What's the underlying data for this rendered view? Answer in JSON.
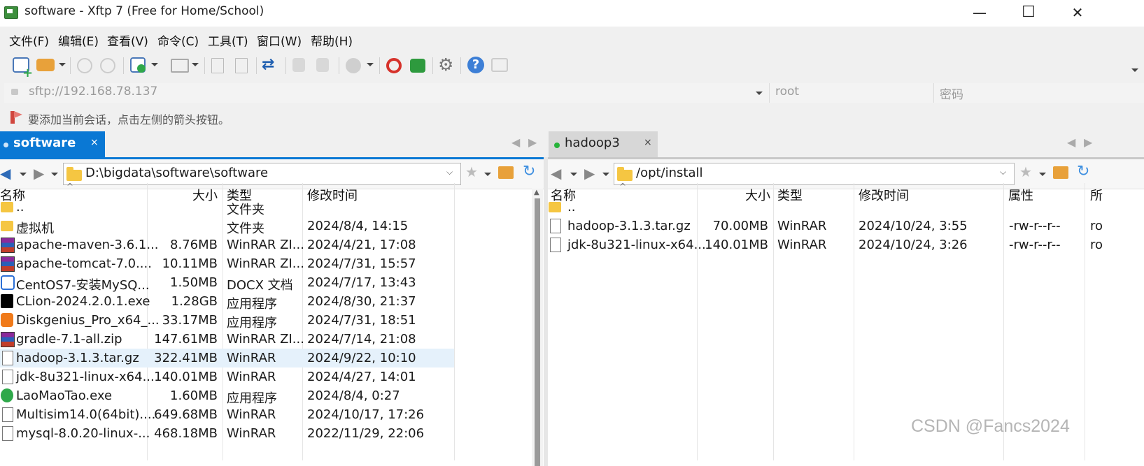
{
  "window": {
    "title": "software - Xftp 7 (Free for Home/School)",
    "minimize": "—",
    "maximize": "☐",
    "close": "✕"
  },
  "menu": [
    "文件(F)",
    "编辑(E)",
    "查看(V)",
    "命令(C)",
    "工具(T)",
    "窗口(W)",
    "帮助(H)"
  ],
  "address": {
    "url": "sftp://192.168.78.137",
    "user": "root",
    "password_placeholder": "密码"
  },
  "hint": "要添加当前会话，点击左侧的箭头按钮。",
  "left_pane": {
    "tab": "software",
    "path": "D:\\bigdata\\software\\software",
    "columns": [
      "名称",
      "大小",
      "类型",
      "修改时间"
    ],
    "rows": [
      {
        "name": "..",
        "size": "",
        "type": "文件夹",
        "modified": "",
        "icon": "folder"
      },
      {
        "name": "虚拟机",
        "size": "",
        "type": "文件夹",
        "modified": "2024/8/4, 14:15",
        "icon": "folder"
      },
      {
        "name": "apache-maven-3.6.1...",
        "size": "8.76MB",
        "type": "WinRAR ZI...",
        "modified": "2024/4/21, 17:08",
        "icon": "rar"
      },
      {
        "name": "apache-tomcat-7.0....",
        "size": "10.11MB",
        "type": "WinRAR ZI...",
        "modified": "2024/7/31, 15:57",
        "icon": "rar"
      },
      {
        "name": "CentOS7-安装MySQ...",
        "size": "1.50MB",
        "type": "DOCX 文档",
        "modified": "2024/7/17, 13:43",
        "icon": "word"
      },
      {
        "name": "CLion-2024.2.0.1.exe",
        "size": "1.28GB",
        "type": "应用程序",
        "modified": "2024/8/30, 21:37",
        "icon": "clion"
      },
      {
        "name": "Diskgenius_Pro_x64_...",
        "size": "33.17MB",
        "type": "应用程序",
        "modified": "2024/7/31, 18:51",
        "icon": "dg"
      },
      {
        "name": "gradle-7.1-all.zip",
        "size": "147.61MB",
        "type": "WinRAR ZI...",
        "modified": "2024/7/14, 21:08",
        "icon": "rar"
      },
      {
        "name": "hadoop-3.1.3.tar.gz",
        "size": "322.41MB",
        "type": "WinRAR",
        "modified": "2024/9/22, 10:10",
        "icon": "doc",
        "selected": true
      },
      {
        "name": "jdk-8u321-linux-x64...",
        "size": "140.01MB",
        "type": "WinRAR",
        "modified": "2024/4/27, 14:01",
        "icon": "doc"
      },
      {
        "name": "LaoMaoTao.exe",
        "size": "1.60MB",
        "type": "应用程序",
        "modified": "2024/8/4, 0:27",
        "icon": "lmt"
      },
      {
        "name": "Multisim14.0(64bit)....",
        "size": "649.68MB",
        "type": "WinRAR",
        "modified": "2024/10/17, 17:26",
        "icon": "doc"
      },
      {
        "name": "mysql-8.0.20-linux-...",
        "size": "468.18MB",
        "type": "WinRAR",
        "modified": "2022/11/29, 22:06",
        "icon": "doc"
      }
    ]
  },
  "right_pane": {
    "tab": "hadoop3",
    "path": "/opt/install",
    "columns": [
      "名称",
      "大小",
      "类型",
      "修改时间",
      "属性",
      "所"
    ],
    "rows": [
      {
        "name": "..",
        "size": "",
        "type": "",
        "modified": "",
        "attr": "",
        "owner": "",
        "icon": "folder"
      },
      {
        "name": "hadoop-3.1.3.tar.gz",
        "size": "70.00MB",
        "type": "WinRAR",
        "modified": "2024/10/24, 3:55",
        "attr": "-rw-r--r--",
        "owner": "ro",
        "icon": "doc"
      },
      {
        "name": "jdk-8u321-linux-x64...",
        "size": "140.01MB",
        "type": "WinRAR",
        "modified": "2024/10/24, 3:26",
        "attr": "-rw-r--r--",
        "owner": "ro",
        "icon": "doc"
      }
    ]
  },
  "watermark": "CSDN @Fancs2024",
  "colors": {
    "accent": "#0a78d4",
    "selection": "#e5f1fb",
    "chrome": "#f0f0f0"
  }
}
